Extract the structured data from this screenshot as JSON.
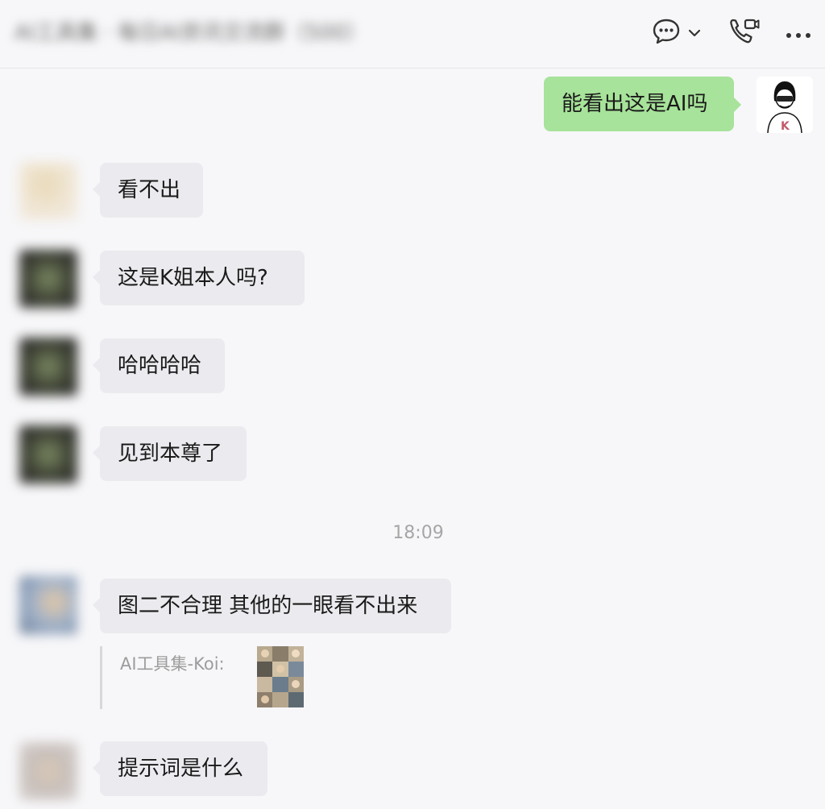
{
  "header": {
    "title": "AI工具集 · 每日AI资讯交流群（500）",
    "icons": [
      "chat-bubble-icon",
      "chevron-down-icon",
      "video-call-icon",
      "more-icon"
    ]
  },
  "messages": [
    {
      "sender": "self",
      "text": "能看出这是AI吗"
    },
    {
      "sender": "other",
      "text": "看不出"
    },
    {
      "sender": "other",
      "text": "这是K姐本人吗?"
    },
    {
      "sender": "other",
      "text": "哈哈哈哈"
    },
    {
      "sender": "other",
      "text": "见到本尊了"
    },
    {
      "sender": "other",
      "text": "图二不合理 其他的一眼看不出来",
      "quote": {
        "author_label": "AI工具集-Koi:",
        "attachment": "image-thumbnail"
      }
    },
    {
      "sender": "other",
      "text": "提示词是什么"
    }
  ],
  "timestamp": "18:09",
  "self_avatar": {
    "badge_letter": "K"
  },
  "colors": {
    "background": "#f7f7f9",
    "incoming_bubble": "#ebebef",
    "outgoing_bubble": "#a7e39a",
    "timestamp_text": "#a6a6a6"
  }
}
